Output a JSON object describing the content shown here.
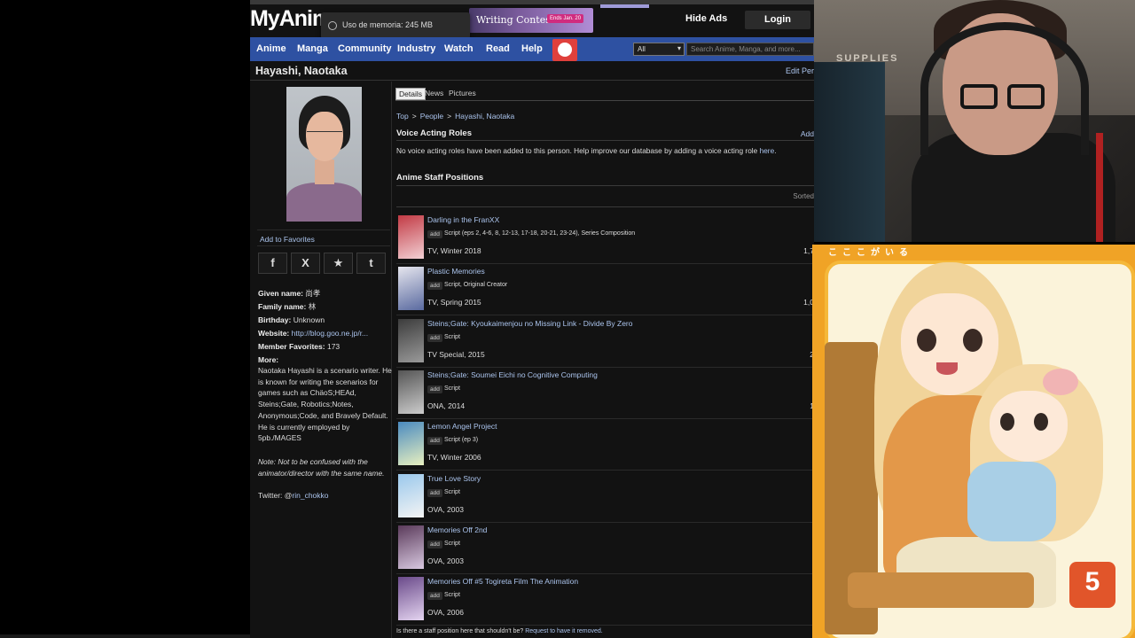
{
  "header": {
    "logo": "MyAnim",
    "memory_tooltip": "Uso de memoria: 245 MB",
    "ad_text": "Writing Contest",
    "ad_badge": "Ends Jan. 20",
    "hide_ads": "Hide Ads",
    "login": "Login"
  },
  "nav": {
    "items": [
      "Anime",
      "Manga",
      "Community",
      "Industry",
      "Watch",
      "Read",
      "Help"
    ],
    "select_value": "All",
    "search_placeholder": "Search Anime, Manga, and more..."
  },
  "page": {
    "title": "Hayashi, Naotaka",
    "edit": "Edit Per"
  },
  "sidebar": {
    "add_favorites": "Add to Favorites",
    "share": [
      "f",
      "X",
      "★",
      "t"
    ],
    "given_name_label": "Given name:",
    "given_name": "尚孝",
    "family_name_label": "Family name:",
    "family_name": "林",
    "birthday_label": "Birthday:",
    "birthday": "Unknown",
    "website_label": "Website:",
    "website": "http://blog.goo.ne.jp/r...",
    "favorites_label": "Member Favorites:",
    "favorites": "173",
    "more_label": "More:",
    "more_text": "Naotaka Hayashi is a scenario writer. He is known for writing the scenarios for games such as ChäoS;HEAd, Steins;Gate, Robotics;Notes, Anonymous;Code, and Bravely Default. He is currently employed by 5pb./MAGES",
    "note": "Note: Not to be confused with the animator/director with the same name.",
    "twitter_label": "Twitter: @",
    "twitter": "rin_chokko"
  },
  "tabs": [
    "Details",
    "News",
    "Pictures"
  ],
  "breadcrumb": [
    "Top",
    "People",
    "Hayashi, Naotaka"
  ],
  "voice": {
    "heading": "Voice Acting Roles",
    "add": "Add",
    "empty_text": "No voice acting roles have been added to this person. Help improve our database by adding a voice acting role ",
    "here": "here",
    "period": "."
  },
  "staff": {
    "heading": "Anime Staff Positions",
    "sorted": "Sorted",
    "add_chip": "add",
    "rows": [
      {
        "title": "Darling in the FranXX",
        "role": "Script (eps 2, 4-6, 8, 12-13, 17-18, 20-21, 23-24), Series Composition",
        "meta": "TV, Winter 2018",
        "members": "1,7"
      },
      {
        "title": "Plastic Memories",
        "role": "Script, Original Creator",
        "meta": "TV, Spring 2015",
        "members": "1,0"
      },
      {
        "title": "Steins;Gate: Kyoukaimenjou no Missing Link - Divide By Zero",
        "role": "Script",
        "meta": "TV Special, 2015",
        "members": "2"
      },
      {
        "title": "Steins;Gate: Soumei Eichi no Cognitive Computing",
        "role": "Script",
        "meta": "ONA, 2014",
        "members": "1"
      },
      {
        "title": "Lemon Angel Project",
        "role": "Script (ep 3)",
        "meta": "TV, Winter 2006",
        "members": ""
      },
      {
        "title": "True Love Story",
        "role": "Script",
        "meta": "OVA, 2003",
        "members": ""
      },
      {
        "title": "Memories Off 2nd",
        "role": "Script",
        "meta": "OVA, 2003",
        "members": ""
      },
      {
        "title": "Memories Off #5 Togireta Film The Animation",
        "role": "Script",
        "meta": "OVA, 2006",
        "members": ""
      }
    ],
    "footer_text": "Is there a staff position here that shouldn't be? ",
    "footer_link": "Request to have it removed."
  },
  "webcam": {
    "shelf_text": "SUPPLIES"
  },
  "art": {
    "badge": "5",
    "top_text": "こここがいる"
  },
  "colors": {
    "nav_blue": "#2e51a2",
    "link": "#abc4ed",
    "page_bg": "#121212",
    "art_orange": "#f0a326"
  }
}
